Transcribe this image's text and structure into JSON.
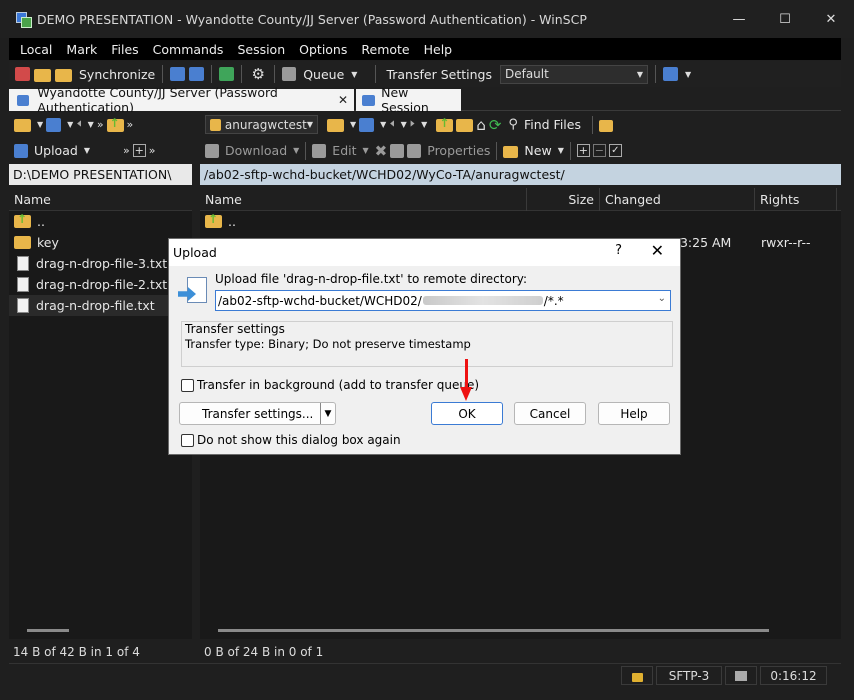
{
  "window": {
    "title": "DEMO PRESENTATION - Wyandotte County/JJ Server (Password Authentication) - WinSCP"
  },
  "menu": [
    "Local",
    "Mark",
    "Files",
    "Commands",
    "Session",
    "Options",
    "Remote",
    "Help"
  ],
  "toolbar": {
    "synchronize": "Synchronize",
    "queue": "Queue",
    "transfer_settings_label": "Transfer Settings",
    "transfer_settings_value": "Default"
  },
  "tabs": {
    "active": "Wyandotte County/JJ Server (Password Authentication)",
    "new_session": "New Session"
  },
  "local": {
    "upload": "Upload",
    "path": "D:\\DEMO PRESENTATION\\",
    "col_name": "Name",
    "files": [
      "..",
      "key",
      "drag-n-drop-file-3.txt",
      "drag-n-drop-file-2.txt",
      "drag-n-drop-file.txt"
    ],
    "status": "14 B of 42 B in 1 of 4"
  },
  "remote": {
    "dir_combo": "anuragwctest",
    "find_files": "Find Files",
    "download": "Download",
    "edit": "Edit",
    "properties": "Properties",
    "new": "New",
    "path": "/ab02-sftp-wchd-bucket/WCHD02/WyCo-TA/anuragwctest/",
    "col_name": "Name",
    "col_size": "Size",
    "col_changed": "Changed",
    "col_rights": "Rights",
    "row_changed_partial": "43:25 AM",
    "row_rights": "rwxr--r--",
    "status": "0 B of 24 B in 0 of 1"
  },
  "bottom": {
    "protocol": "SFTP-3",
    "time": "0:16:12"
  },
  "dialog": {
    "title": "Upload",
    "help_icon": "?",
    "prompt": "Upload file 'drag-n-drop-file.txt' to remote directory:",
    "path_start": "/ab02-sftp-wchd-bucket/WCHD02/",
    "path_end": "/*.*",
    "group_title": "Transfer settings",
    "group_text": "Transfer type: Binary; Do not preserve timestamp",
    "background_chk": "Transfer in background (add to transfer queue)",
    "transfer_settings_btn": "Transfer settings...",
    "ok": "OK",
    "cancel": "Cancel",
    "help": "Help",
    "dont_show_chk": "Do not show this dialog box again"
  }
}
